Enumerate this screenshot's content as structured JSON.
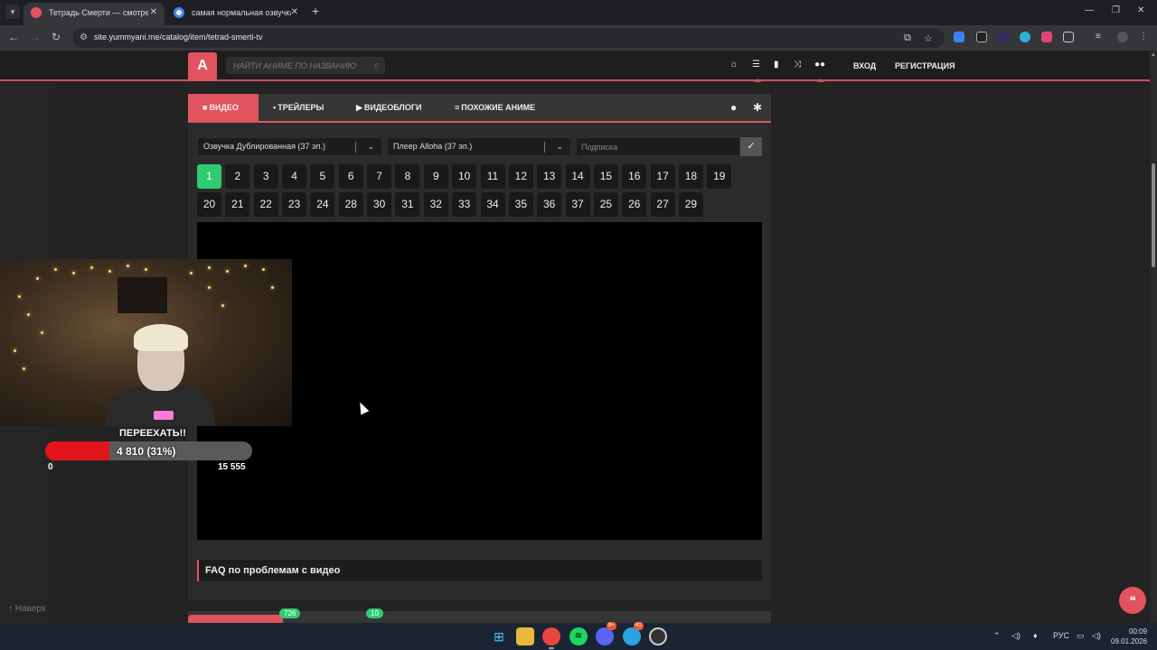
{
  "browser": {
    "tabs": [
      {
        "title": "Тетрадь Смерти — смотреть аниме",
        "active": true
      },
      {
        "title": "самая нормальная озвучка тетради",
        "active": false
      }
    ],
    "url": "site.yummyani.me/catalog/item/tetrad-smerti-tv"
  },
  "header": {
    "logo_text": "A",
    "search_placeholder": "НАЙТИ АНИМЕ ПО НАЗВАНИЮ",
    "login": "ВХОД",
    "register": "РЕГИСТРАЦИЯ"
  },
  "card": {
    "tabs": [
      {
        "label": "ВИДЕО",
        "icon": "video-camera-icon"
      },
      {
        "label": "ТРЕЙЛЕРЫ",
        "icon": "file-icon"
      },
      {
        "label": "ВИДЕОБЛОГИ",
        "icon": "youtube-icon"
      },
      {
        "label": "ПОХОЖИЕ АНИМЕ",
        "icon": "list-icon"
      }
    ],
    "dub_select": "Озвучка Дублированная (37 эп.)",
    "player_select": "Плеер Alloha (37 эп.)",
    "subscribe_placeholder": "Подписка",
    "episodes_row1": [
      "1",
      "2",
      "3",
      "4",
      "5",
      "6",
      "7",
      "8",
      "9",
      "10",
      "11",
      "12",
      "13",
      "14",
      "15",
      "16",
      "17",
      "18",
      "19"
    ],
    "episodes_row2": [
      "20",
      "21",
      "22",
      "23",
      "24",
      "28",
      "30",
      "31",
      "32",
      "33",
      "34",
      "35",
      "36",
      "37",
      "25",
      "26",
      "27",
      "29"
    ],
    "active_episode": "1",
    "faq": "FAQ по проблемам с видео",
    "bottom_badges": [
      "726",
      "10"
    ]
  },
  "to_top": "↑ Наверх",
  "overlay": {
    "goal_title": "ПЕРЕЕХАТЬ!!",
    "goal_value": "4 810  (31%)",
    "goal_progress": 0.31,
    "goal_min": "0",
    "goal_max": "15 555"
  },
  "taskbar": {
    "lang": "РУС",
    "time": "00:09",
    "date": "09.01.2026",
    "discord_badge": "9+",
    "telegram_badge": "41"
  },
  "colors": {
    "accent": "#e0535f",
    "active_episode": "#2ecc71",
    "goal_fill": "#e3141b"
  }
}
